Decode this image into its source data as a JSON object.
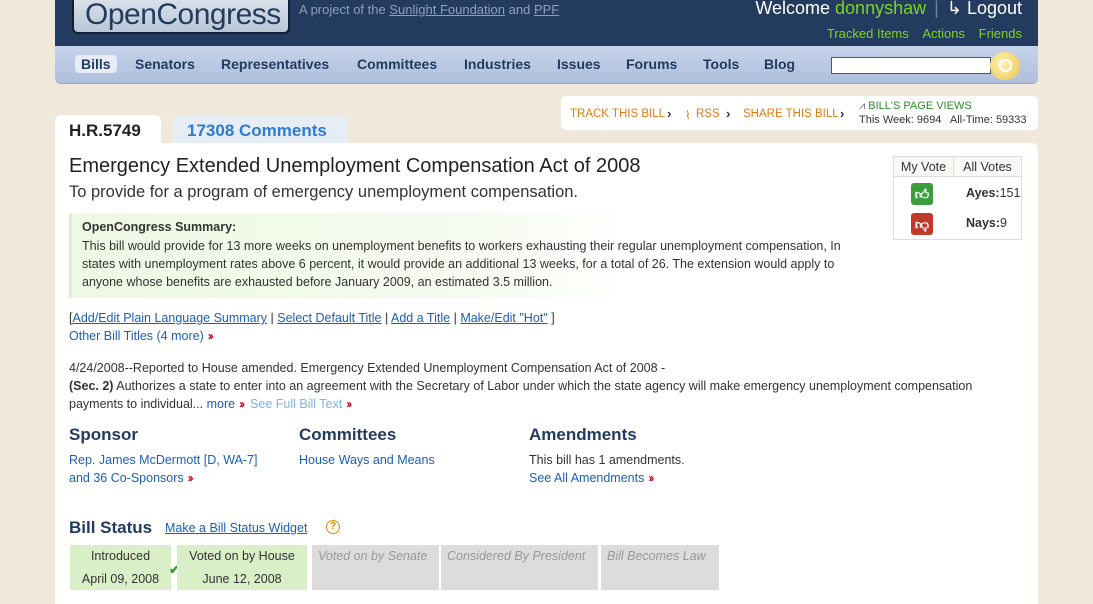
{
  "header": {
    "logo": "OpenCongress",
    "tagline_prefix": "A project of the",
    "tagline_link1": "Sunlight Foundation",
    "tagline_and": "and",
    "tagline_link2": "PPF",
    "welcome": "Welcome",
    "username": "donnyshaw",
    "separator": "|",
    "logout": "Logout",
    "tracked": "Tracked Items",
    "actions": "Actions",
    "friends": "Friends"
  },
  "nav": {
    "items": [
      "Bills",
      "Senators",
      "Representatives",
      "Committees",
      "Industries",
      "Issues",
      "Forums",
      "Tools",
      "Blog"
    ],
    "search_value": ""
  },
  "tabs": {
    "bill": "H.R.5749",
    "comments": "17308 Comments"
  },
  "trackbar": {
    "track": "TRACK THIS BILL",
    "rss": "RSS",
    "share": "SHARE THIS BILL",
    "page_views_title": "BILL'S PAGE VIEWS",
    "this_week": "This Week: 9694",
    "all_time": "All-Time: 59333"
  },
  "bill": {
    "title": "Emergency Extended Unemployment Compensation Act of 2008",
    "description": "To provide for a program of emergency unemployment compensation.",
    "summary_heading": "OpenCongress Summary:",
    "summary_text": "This bill would provide for 13 more weeks on unemployment benefits to workers exhausting their regular unemployment compensation, In states with unemployment rates above 6 percent, it would provide an additional 13 weeks, for a total of 26. The extension would apply to anyone whose benefits are exhausted before January 2009, an estimated 3.5 million."
  },
  "votes": {
    "my_vote": "My Vote",
    "all_votes": "All Votes",
    "ayes_label": "Ayes:",
    "ayes": "151",
    "nays_label": "Nays:",
    "nays": "9"
  },
  "links": {
    "open_bracket": "[",
    "close_bracket": "]",
    "pipe": "|",
    "edit_summary": "Add/Edit Plain Language Summary",
    "default_title": "Select Default Title",
    "add_title": "Add a Title",
    "hot": "Make/Edit \"Hot\"",
    "other_titles": "Other Bill Titles (4 more)"
  },
  "action": {
    "line1": "4/24/2008--Reported to House amended. Emergency Extended Unemployment Compensation Act of 2008 -",
    "sec": "(Sec. 2)",
    "line2": " Authorizes a state to enter into an agreement with the Secretary of Labor under which the state agency will make emergency unemployment compensation payments to individual...",
    "more": "more",
    "full_text": "See Full Bill Text"
  },
  "sponsor": {
    "heading": "Sponsor",
    "name": "Rep. James McDermott [D, WA-7]",
    "cosponsors": "and 36 Co-Sponsors"
  },
  "committees": {
    "heading": "Committees",
    "name": "House Ways and Means"
  },
  "amendments": {
    "heading": "Amendments",
    "count_text": "This bill has 1 amendments.",
    "see_all": "See All Amendments"
  },
  "status": {
    "heading": "Bill Status",
    "widget_link": "Make a Bill Status Widget",
    "help": "?",
    "stages": [
      {
        "label": "Introduced",
        "date": "April 09, 2008"
      },
      {
        "label": "Voted on by House",
        "date": "June 12, 2008"
      },
      {
        "label": "Voted on by Senate"
      },
      {
        "label": "Considered By President"
      },
      {
        "label": "Bill Becomes Law"
      }
    ]
  },
  "colors": {
    "header_bg": "#223b5e",
    "nav_bg": "#b9c8e3",
    "accent_green": "#7ed321",
    "link_blue": "#1a5fb4",
    "track_orange": "#e07b11",
    "status_done": "#d9efc7",
    "status_todo": "#dcdcdc"
  }
}
